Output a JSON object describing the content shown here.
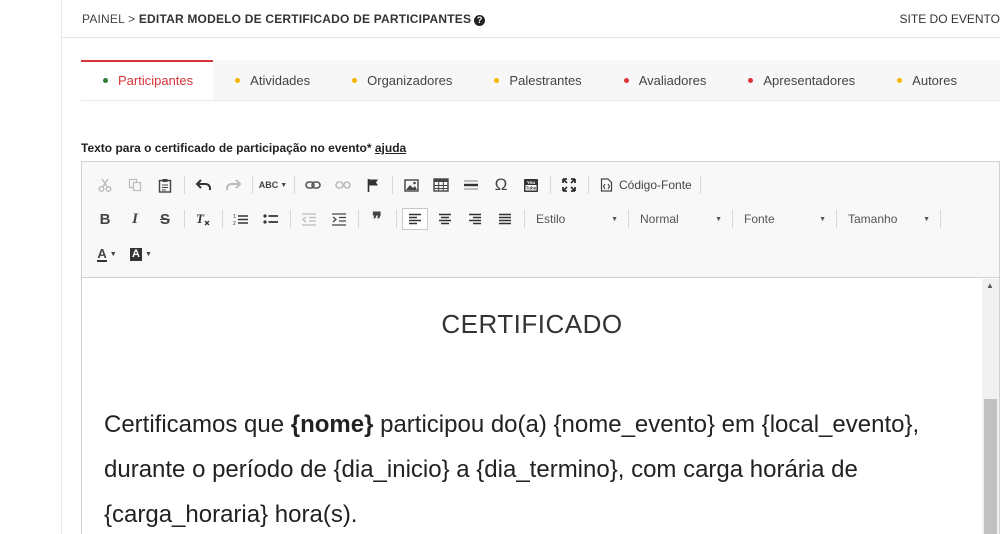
{
  "header": {
    "breadcrumb_root": "PAINEL",
    "breadcrumb_sep": " > ",
    "breadcrumb_current": "EDITAR MODELO DE CERTIFICADO DE PARTICIPANTES",
    "help_glyph": "?",
    "site_link": "SITE DO EVENTO"
  },
  "tabs": [
    {
      "label": "Participantes",
      "dot_color": "#2e7d32",
      "active": true
    },
    {
      "label": "Atividades",
      "dot_color": "#f5b800"
    },
    {
      "label": "Organizadores",
      "dot_color": "#f5b800"
    },
    {
      "label": "Palestrantes",
      "dot_color": "#f5b800"
    },
    {
      "label": "Avaliadores",
      "dot_color": "#d9343a"
    },
    {
      "label": "Apresentadores",
      "dot_color": "#d9343a"
    },
    {
      "label": "Autores",
      "dot_color": "#f5b800"
    }
  ],
  "field": {
    "label": "Texto para o certificado de participação no evento* ",
    "help_link": "ajuda"
  },
  "toolbar": {
    "source_label": "Código-Fonte",
    "style_combo": "Estilo",
    "format_combo": "Normal",
    "font_combo": "Fonte",
    "size_combo": "Tamanho",
    "bold": "B",
    "italic": "I",
    "strike": "S",
    "spellcheck": "ABC",
    "omega": "Ω",
    "quote": "❞",
    "text_color": "A",
    "bg_color": "A"
  },
  "content": {
    "title": "CERTIFICADO",
    "p1": "Certificamos que ",
    "name_var": "{nome}",
    "p2": " participou do(a) {nome_evento} em {local_evento}, durante o período de {dia_inicio} a {dia_termino}, com carga horária de {carga_horaria} hora(s)."
  },
  "colors": {
    "accent": "#d9343a"
  }
}
